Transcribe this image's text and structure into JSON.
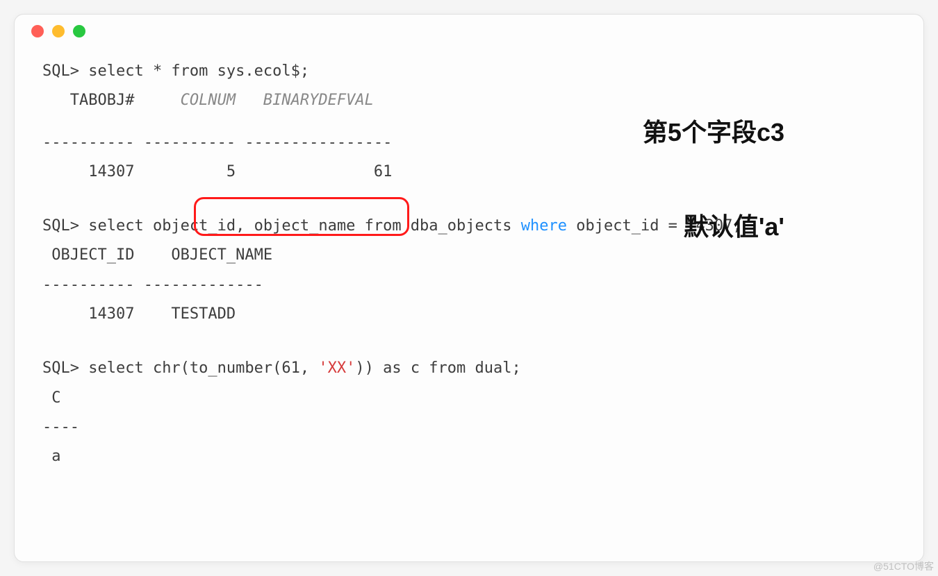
{
  "query1": {
    "prompt": "SQL>",
    "sql": " select * from sys.ecol$;",
    "header_tabobj": "   TABOBJ#",
    "header_colnum": "     COLNUM",
    "header_bindefval": "   BINARYDEFVAL",
    "divider": "---------- ---------- ----------------",
    "row_tabobj": "     14307",
    "row_colnum": "          5",
    "row_bindefval": "               61"
  },
  "query2": {
    "prompt": "SQL>",
    "sql_pre": " select object_id, object_name from dba_objects ",
    "sql_where": "where",
    "sql_post": " object_id = 14307;",
    "header": " OBJECT_ID    OBJECT_NAME",
    "divider": "---------- -------------",
    "row": "     14307    TESTADD"
  },
  "query3": {
    "prompt": "SQL>",
    "sql_pre": " select chr(to_number(61, ",
    "sql_str": "'XX'",
    "sql_post": ")) as c from dual;",
    "header": " C",
    "divider": "----",
    "row": " a"
  },
  "annotations": {
    "line1": "第5个字段c3",
    "line2": "默认值'a'"
  },
  "watermark": "@51CTO博客"
}
